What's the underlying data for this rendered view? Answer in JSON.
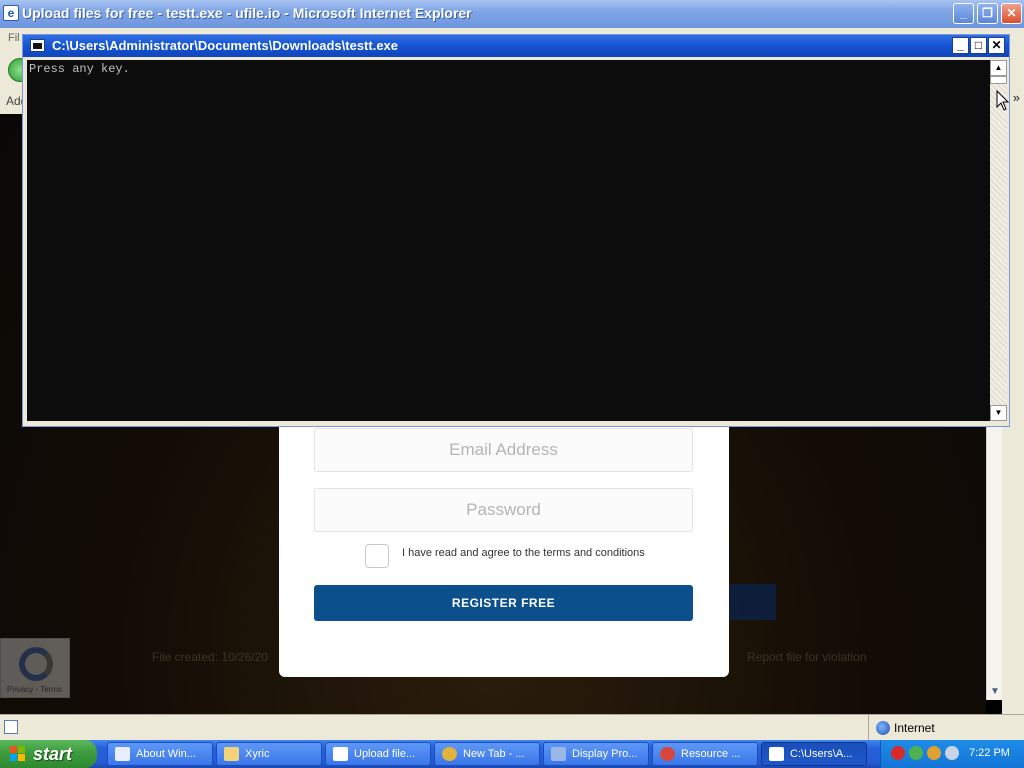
{
  "ie": {
    "title": "Upload files for free - testt.exe - ufile.io - Microsoft Internet Explorer",
    "menu_fragment": "Fil",
    "address_fragment": "Add",
    "chevron": "»",
    "window_buttons": {
      "minimize": "_",
      "restore": "❐",
      "close": "✕"
    }
  },
  "page": {
    "email_placeholder": "Email Address",
    "password_placeholder": "Password",
    "agree_text": "I have read and agree to the terms and conditions",
    "register_label": "REGISTER FREE",
    "file_created": "File created: 10/26/20",
    "report_link": "Report file for violation",
    "recaptcha_terms": "Privacy - Terms"
  },
  "console": {
    "title": "C:\\Users\\Administrator\\Documents\\Downloads\\testt.exe",
    "output": "Press any key.",
    "buttons": {
      "minimize": "_",
      "maximize": "□",
      "close": "✕"
    },
    "scroll_up": "▲",
    "scroll_down": "▼"
  },
  "statusbar": {
    "zone_label": "Internet"
  },
  "taskbar": {
    "start_label": "start",
    "tasks": [
      {
        "label": "About Win...",
        "icon": "window-icon",
        "color": "#e8eefc"
      },
      {
        "label": "Xyric",
        "icon": "folder-icon",
        "color": "#f3d27a"
      },
      {
        "label": "Upload file...",
        "icon": "ie-icon",
        "color": "#ffffff"
      },
      {
        "label": "New Tab - ...",
        "icon": "chrome-icon",
        "color": "#e2b33c"
      },
      {
        "label": "Display Pro...",
        "icon": "display-icon",
        "color": "#9ab7e8"
      },
      {
        "label": "Resource ...",
        "icon": "resource-icon",
        "color": "#d9463b"
      },
      {
        "label": "C:\\Users\\A...",
        "icon": "console-icon",
        "color": "#ffffff"
      }
    ],
    "clock": "7:22 PM",
    "tray_icons": [
      "shield-icon",
      "network-icon",
      "security-icon",
      "volume-icon"
    ]
  },
  "colors": {
    "register_button": "#0b4f8c",
    "console_bg": "#0c0c0c",
    "xp_blue": "#245bd4",
    "start_green": "#3d9a3d"
  }
}
